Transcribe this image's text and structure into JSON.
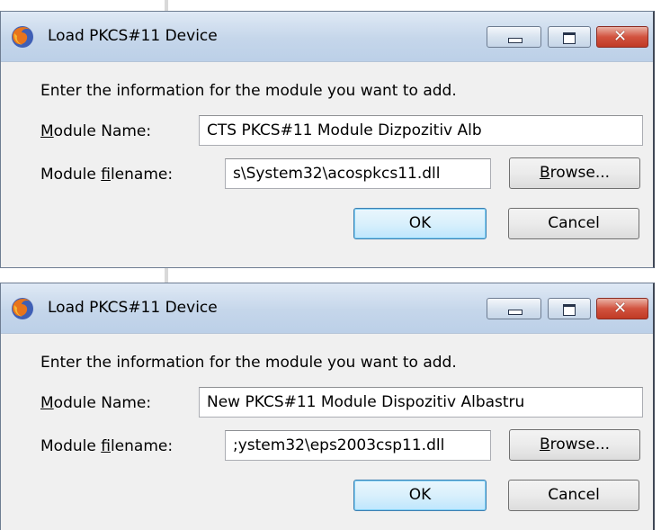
{
  "dialogs": [
    {
      "title": "Load PKCS#11 Device",
      "instruction": "Enter the information for the module you want to add.",
      "module_name_label_prefix": "M",
      "module_name_label_rest": "odule Name:",
      "module_name_value": "CTS PKCS#11 Module Dizpozitiv Alb",
      "module_filename_label_pre": "Module ",
      "module_filename_label_underlined": "f",
      "module_filename_label_post": "ilename:",
      "module_filename_value": "s\\System32\\acospkcs11.dll",
      "browse_label_underlined": "B",
      "browse_label_rest": "rowse...",
      "ok_label": "OK",
      "cancel_label": "Cancel"
    },
    {
      "title": "Load PKCS#11 Device",
      "instruction": "Enter the information for the module you want to add.",
      "module_name_label_prefix": "M",
      "module_name_label_rest": "odule Name:",
      "module_name_value": "New PKCS#11 Module Dispozitiv Albastru",
      "module_filename_label_pre": "Module ",
      "module_filename_label_underlined": "f",
      "module_filename_label_post": "ilename:",
      "module_filename_value": ";ystem32\\eps2003csp11.dll",
      "browse_label_underlined": "B",
      "browse_label_rest": "rowse...",
      "ok_label": "OK",
      "cancel_label": "Cancel"
    }
  ],
  "icons": {
    "app": "firefox-icon",
    "minimize": "minimize-icon",
    "maximize": "maximize-icon",
    "close": "close-icon"
  },
  "colors": {
    "titlebar": "#c5d6ea",
    "close_button": "#c03a25",
    "dialog_bg": "#f0f0f0",
    "default_button_border": "#3c7fb1"
  }
}
